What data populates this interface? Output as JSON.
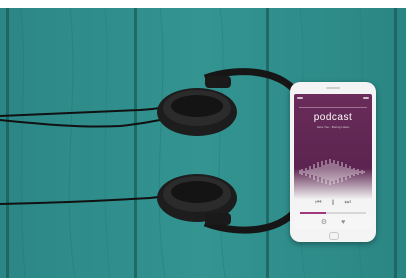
{
  "photo": {
    "subject": "headphones and smartphone on teal wooden table",
    "colors": {
      "wood": "#2f8f8c",
      "wood_dark": "#1f6d6b",
      "headphones": "#1a1a1a",
      "screen_accent": "#6a2c5a"
    }
  },
  "phone_screen": {
    "title": "podcast",
    "subtitle": "Here You - Boring Listen",
    "controls": {
      "prev_icon": "⏮",
      "pause_icon": "‖",
      "next_icon": "⏭"
    },
    "progress_fraction": 0.4,
    "bottom_icons": {
      "share_icon": "⚙",
      "like_icon": "♥"
    }
  }
}
